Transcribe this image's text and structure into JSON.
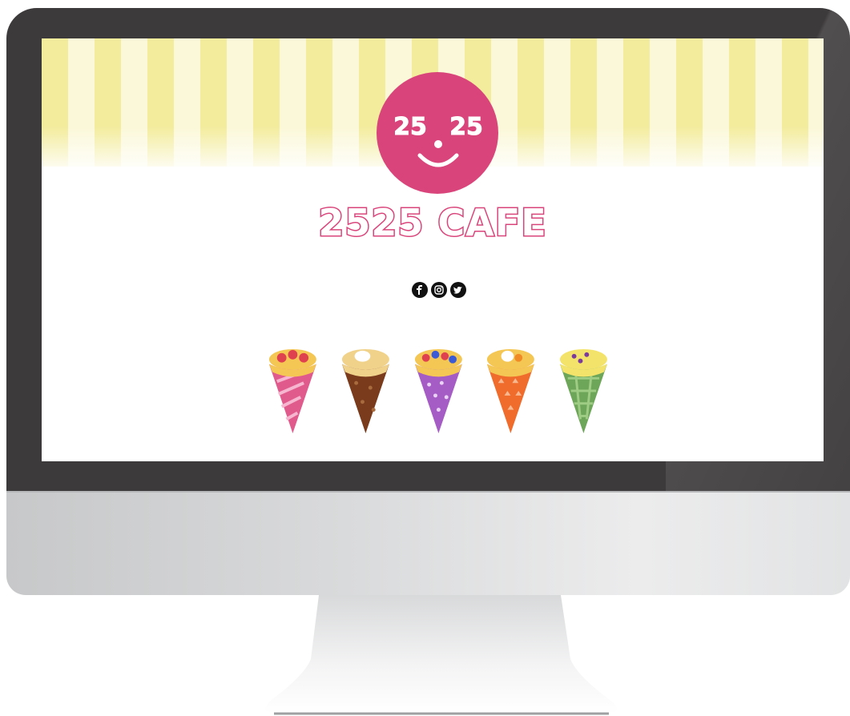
{
  "site": {
    "brand_name": "2525 CAFE",
    "logo_face_text": "25",
    "accent_color": "#d9457a",
    "awning_colors": [
      "#f3ec9d",
      "#fbf8d9"
    ]
  },
  "social": [
    {
      "name": "facebook",
      "icon": "facebook-icon"
    },
    {
      "name": "instagram",
      "icon": "instagram-icon"
    },
    {
      "name": "twitter",
      "icon": "twitter-icon"
    }
  ],
  "crepes": [
    {
      "flavor": "strawberry",
      "wrapper_color": "#e05a8c"
    },
    {
      "flavor": "chocolate",
      "wrapper_color": "#7a3b1c"
    },
    {
      "flavor": "berry",
      "wrapper_color": "#a55cc4"
    },
    {
      "flavor": "orange",
      "wrapper_color": "#ef6c2c"
    },
    {
      "flavor": "matcha",
      "wrapper_color": "#6ea659"
    }
  ]
}
